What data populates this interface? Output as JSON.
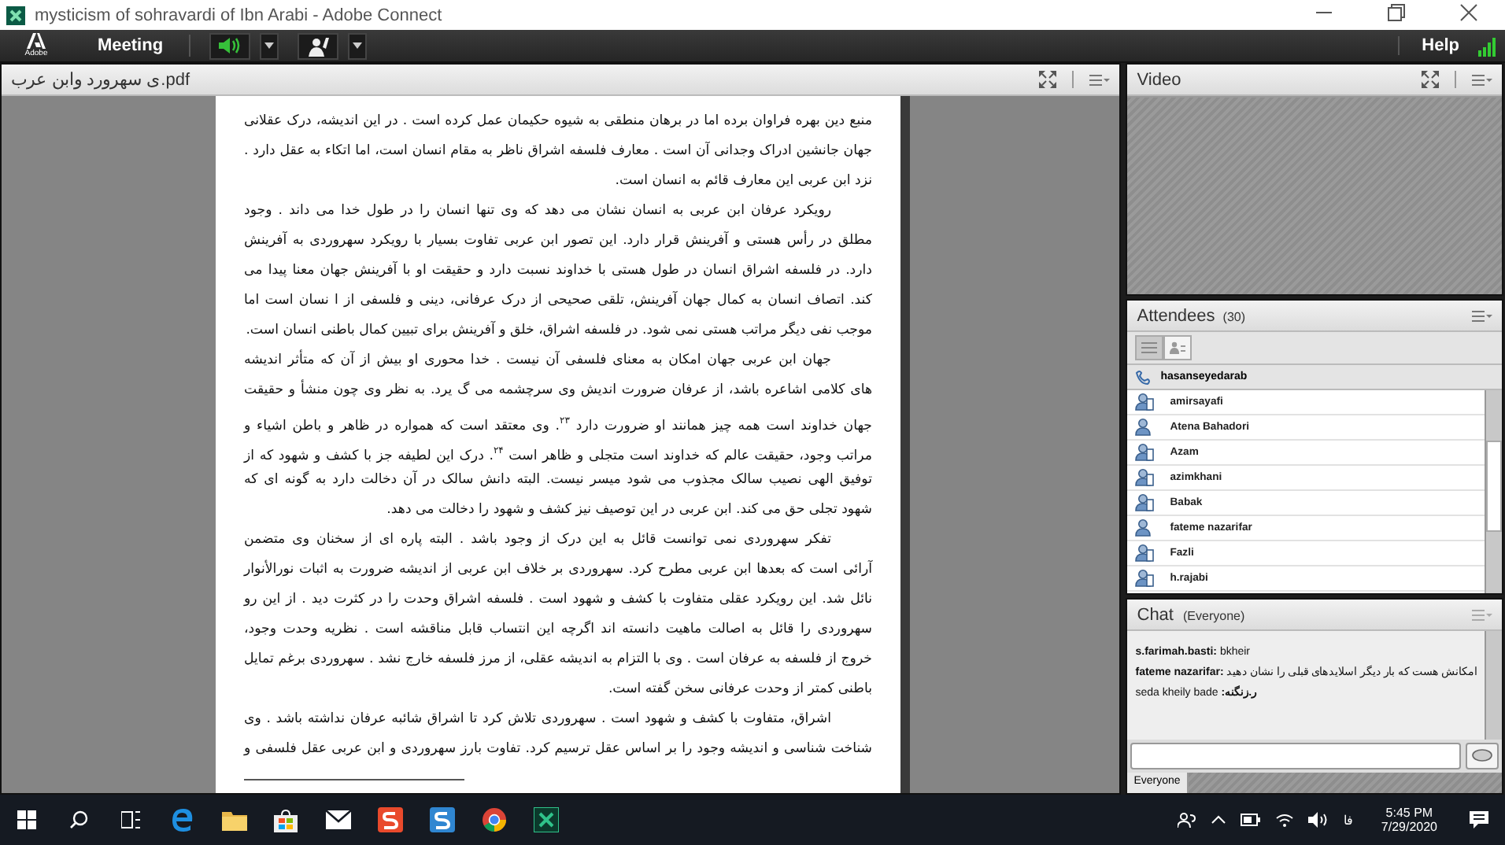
{
  "window": {
    "title": "mysticism of sohravardi of Ibn Arabi - Adobe Connect"
  },
  "meeting_bar": {
    "logo": "Adobe",
    "menu": "Meeting",
    "help": "Help",
    "speaker_on": true
  },
  "document": {
    "title": "ی سهرورد وابن عرب.pdf",
    "lines": [
      {
        "text": "منبع دین بهره فراوان برده اما در برهان منطقی به شیوه حکیمان عمل کرده است . در این اندیشه، درک عقلانی",
        "indent": false
      },
      {
        "text": "جهان جانشین ادراک وجدانی آن است . معارف فلسفه اشراق ناظر به مقام انسان است، اما اتکاء به عقل دارد .",
        "indent": false
      },
      {
        "text": "نزد ابن عربی این معارف قائم به انسان است.",
        "indent": false,
        "last": true
      },
      {
        "text": "رویکرد عرفان ابن عربی به انسان نشان می دهد که وی تنها انسان را در طول خدا می داند . وجود",
        "indent": true
      },
      {
        "text": "مطلق در رأس هستی و آفرینش قرار دارد. این تصور ابن عربی تفاوت بسیار با رویکرد سهروردی به آفرینش",
        "indent": false
      },
      {
        "text": "دارد. در فلسفه اشراق انسان در طول هستی با خداوند نسبت دارد و حقیقت او با آفرینش جهان معنا پیدا می",
        "indent": false
      },
      {
        "text": "کند. اتصاف انسان به کمال جهان آفرینش، تلقی صحیحی از درک عرفانی، دینی و فلسفی از ا نسان است اما",
        "indent": false
      },
      {
        "text": "موجب نفی دیگر مراتب هستی نمی شود. در فلسفه اشراق، خلق و آفرینش برای تبیین کمال باطنی انسان است.",
        "indent": false,
        "last": true
      },
      {
        "text": "جهان ابن عربی جهان امکان به معنای فلسفی آن نیست . خدا محوری او بیش از آن که متأثر اندیشه",
        "indent": true
      },
      {
        "text": "های کلامی اشاعره باشد، از عرفان ضرورت اندیش وی سرچشمه می گ یرد. به نظر وی چون منشأ و حقیقت",
        "indent": false
      },
      {
        "text": "جهان خداوند است همه چیز همانند او ضرورت دارد $^{۲۳}$. وی معتقد است که همواره در ظاهر و باطن اشیاء و",
        "indent": false
      },
      {
        "text": "مراتب وجود، حقیقت عالم که خداوند است متجلی و ظاهر است $^{۲۴}$. درک این لطیفه جز با کشف و شهود که از",
        "indent": false
      },
      {
        "text": "توفیق الهی نصیب سالک مجذوب می شود میسر نیست. البته دانش سالک در آن دخالت دارد به گونه ای که",
        "indent": false
      },
      {
        "text": "شهود تجلی حق می کند. ابن عربی در این توصیف نیز کشف و شهود را دخالت می دهد.",
        "indent": false,
        "last": true
      },
      {
        "text": "تفکر سهروردی نمی توانست قائل به این درک از وجود باشد . البته پاره ای از سخنان وی متضمن",
        "indent": true
      },
      {
        "text": "آرائی است که بعدها ابن عربی مطرح کرد. سهروردی بر خلاف ابن عربی از اندیشه ضرورت به اثبات نورالأنوار",
        "indent": false
      },
      {
        "text": "نائل شد. این رویکرد عقلی متفاوت با کشف و شهود است . فلسفه اشراق وحدت را در کثرت دید . از این رو",
        "indent": false
      },
      {
        "text": "سهروردی را قائل به اصالت ماهیت دانسته اند اگرچه این انتساب قابل مناقشه است . نظریه وحدت وجود،",
        "indent": false
      },
      {
        "text": "خروج از فلسفه به عرفان است . وی با التزام به اندیشه عقلی، از مرز فلسفه خارج نشد . سهروردی برغم تمایل",
        "indent": false
      },
      {
        "text": "باطنی کمتر از وحدت عرفانی سخن گفته است.",
        "indent": false,
        "last": true
      },
      {
        "text": "اشراق، متفاوت با کشف و شهود است . سهروردی تلاش کرد تا اشراق شائبه عرفان نداشته باشد . وی",
        "indent": true
      },
      {
        "text": "شناخت شناسی و اندیشه وجود را بر اساس عقل ترسیم کرد. تفاوت بارز سهروردی و ابن عربی عقل فلسفی و",
        "indent": false
      }
    ]
  },
  "video": {
    "title": "Video"
  },
  "attendees": {
    "title": "Attendees",
    "count": "(30)",
    "host": "hasanseyedarab",
    "items": [
      {
        "name": "amirsayafi",
        "kind": "device"
      },
      {
        "name": "Atena Bahadori",
        "kind": "single"
      },
      {
        "name": "Azam",
        "kind": "device"
      },
      {
        "name": "azimkhani",
        "kind": "device"
      },
      {
        "name": "Babak",
        "kind": "device"
      },
      {
        "name": "fateme nazarifar",
        "kind": "single"
      },
      {
        "name": "Fazli",
        "kind": "device"
      },
      {
        "name": "h.rajabi",
        "kind": "device"
      }
    ]
  },
  "chat": {
    "title": "Chat",
    "scope": "(Everyone)",
    "messages": [
      {
        "sender": "s.farimah.basti:",
        "text": "bkheir",
        "rtl": false
      },
      {
        "sender": "fateme nazarifar:",
        "text": "امکانش هست که بار  دیگر  اسلایدهای قبلی را نشان دهید",
        "rtl": false
      },
      {
        "sender": "ر.زنگنه:",
        "text": "seda kheily bade",
        "rtl": true
      }
    ],
    "tab": "Everyone"
  },
  "taskbar": {
    "language": "فا",
    "time": "5:45 PM",
    "date": "7/29/2020"
  }
}
